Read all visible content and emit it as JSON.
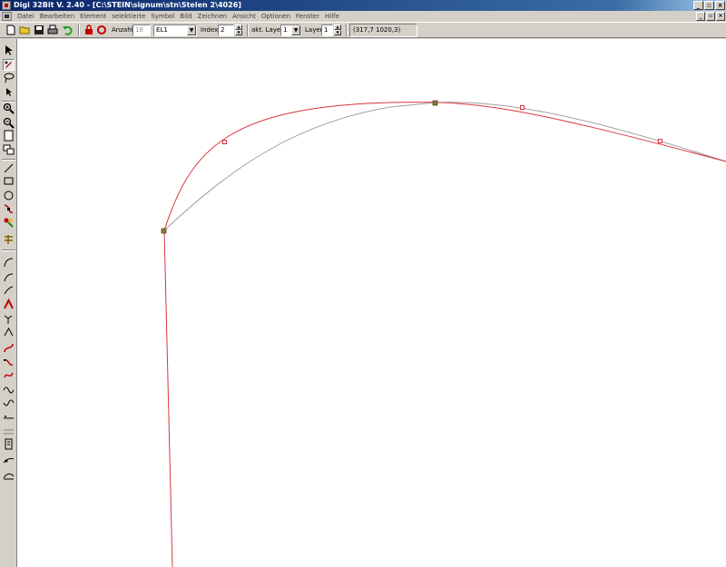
{
  "window": {
    "title": "Digi 32Bit  V. 2.40 - [C:\\STEIN\\signum\\stn\\Stelen 2\\4026]",
    "min_label": "_",
    "max_label": "▫",
    "close_label": "×"
  },
  "menu": {
    "items": [
      "Datei",
      "Bearbeiten",
      "Element",
      "selektierte",
      "Symbol",
      "Bild",
      "Zeichnen",
      "Ansicht",
      "Optionen",
      "Fenster",
      "Hilfe"
    ]
  },
  "toolbar": {
    "anzahl_label": "Anzahl",
    "anzahl_value": "18",
    "element_value": "EL1",
    "index_label": "Index",
    "index_value": "2",
    "akt_layer_label": "akt. Layer",
    "akt_layer_value": "1",
    "layer_label": "Layer",
    "layer_value": "1",
    "coordinates": "(317,7 1020,3)"
  },
  "toolbox": {
    "tools": [
      "select-arrow",
      "node-edit",
      "lasso",
      "pointer",
      "zoom-in",
      "zoom-out",
      "page",
      "windows",
      "line",
      "rectangle",
      "circle",
      "bezier-node",
      "paint",
      "snap",
      "arc-1",
      "arc-2",
      "arc-3",
      "corner-red",
      "corner-2",
      "corner-3",
      "curve-s",
      "curve-2",
      "curve-3",
      "wave",
      "wave-2",
      "text-1",
      "text-2",
      "frame",
      "bend-1",
      "bend-2"
    ]
  },
  "colors": {
    "curve": "#d9363e",
    "guide": "#a0a0a0",
    "anchor": "#8a7a3a",
    "handle": "#d9363e",
    "titlebar": "#0a246a"
  }
}
